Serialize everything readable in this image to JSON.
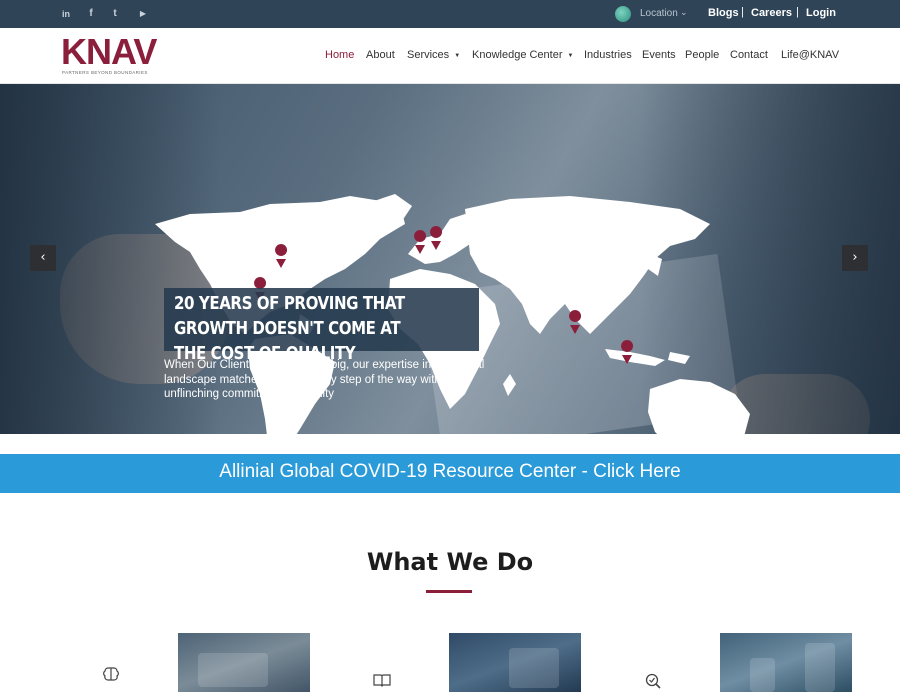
{
  "topbar": {
    "social": [
      "in",
      "f",
      "t",
      "▶"
    ],
    "social_icons": [
      "linkedin-icon",
      "facebook-icon",
      "twitter-icon",
      "youtube-icon"
    ],
    "location_label": "Location",
    "links": [
      "Blogs",
      "Careers",
      "Login"
    ]
  },
  "header": {
    "logo_text": "KNAV",
    "logo_tagline": "PARTNERS BEYOND BOUNDARIES",
    "nav": [
      {
        "label": "Home",
        "active": true
      },
      {
        "label": "About"
      },
      {
        "label": "Services",
        "dropdown": true
      },
      {
        "label": "Knowledge Center",
        "dropdown": true
      },
      {
        "label": "Industries"
      },
      {
        "label": "Events"
      },
      {
        "label": "People"
      },
      {
        "label": "Contact"
      },
      {
        "label": "Life@KNAV"
      }
    ]
  },
  "hero": {
    "headline": "20 YEARS OF PROVING THAT GROWTH DOESN'T COME AT THE COST OF QUALITY",
    "subtext": "When Our Clients dared to think big, our expertise in the global landscape matched them at every step of the way with an unflinching commitment to quality",
    "prev_icon": "chevron-left-icon",
    "next_icon": "chevron-right-icon"
  },
  "banner": {
    "text": "Allinial Global COVID-19 Resource Center - Click Here"
  },
  "what_we_do": {
    "title": "What We Do",
    "services": [
      {
        "icon": "brain-icon"
      },
      {
        "icon": "book-icon"
      },
      {
        "icon": "search-check-icon"
      }
    ]
  },
  "colors": {
    "brand": "#8b1e3a",
    "topbar": "#2f4457",
    "banner": "#2a9ad8"
  }
}
